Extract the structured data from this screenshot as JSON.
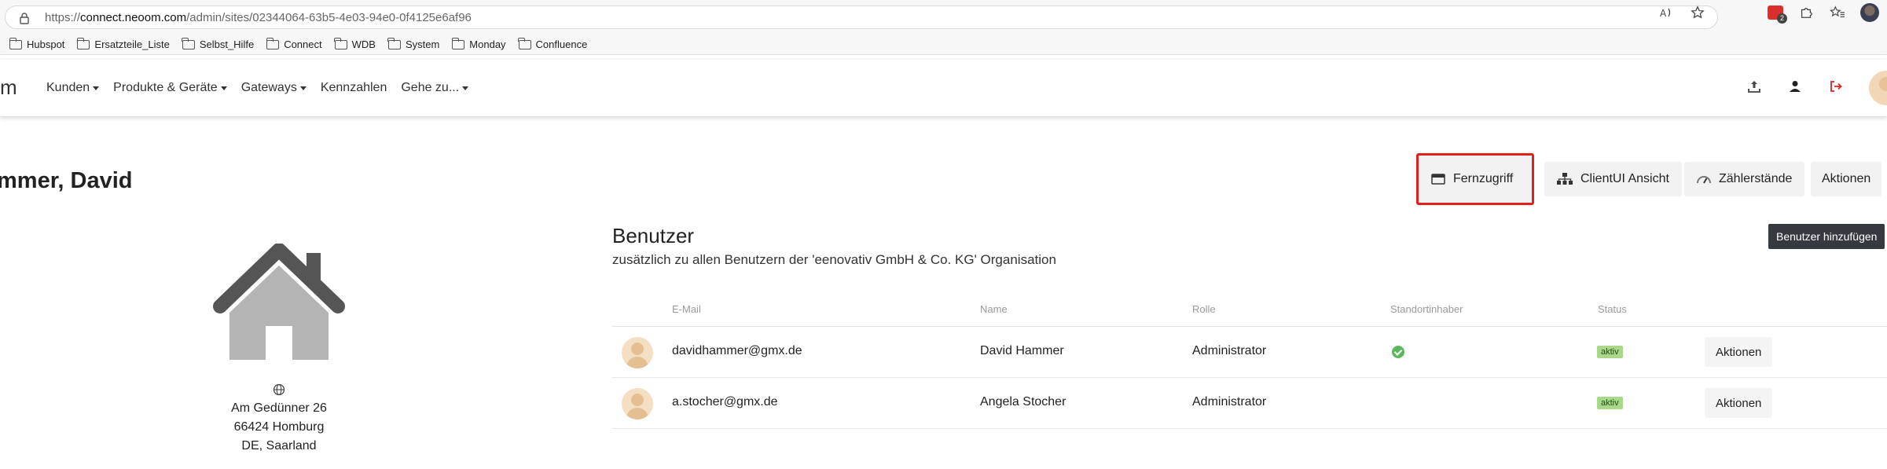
{
  "browser": {
    "url_prefix": "https://",
    "url_domain": "connect.neoom.com",
    "url_path": "/admin/sites/02344064-63b5-4e03-94e0-0f4125e6af96",
    "ext_badge": "2"
  },
  "bookmarks": [
    "Hubspot",
    "Ersatzteile_Liste",
    "Selbst_Hilfe",
    "Connect",
    "WDB",
    "System",
    "Monday",
    "Confluence"
  ],
  "navbar": {
    "logo": "m",
    "items": [
      {
        "label": "Kunden",
        "dropdown": true
      },
      {
        "label": "Produkte & Geräte",
        "dropdown": true
      },
      {
        "label": "Gateways",
        "dropdown": true
      },
      {
        "label": "Kennzahlen",
        "dropdown": false
      },
      {
        "label": "Gehe zu...",
        "dropdown": true
      }
    ]
  },
  "page": {
    "title": "mmer, David",
    "actions": {
      "remote": "Fernzugriff",
      "client_ui": "ClientUI Ansicht",
      "meter": "Zählerstände",
      "actions": "Aktionen"
    }
  },
  "site": {
    "street": "Am Gedünner 26",
    "city": "66424 Homburg",
    "region": "DE, Saarland"
  },
  "users": {
    "title": "Benutzer",
    "subtitle": "zusätzlich zu allen Benutzern der 'eenovativ GmbH & Co. KG' Organisation",
    "add_button": "Benutzer hinzufügen",
    "columns": {
      "email": "E-Mail",
      "name": "Name",
      "role": "Rolle",
      "owner": "Standortinhaber",
      "status": "Status"
    },
    "rows": [
      {
        "email": "davidhammer@gmx.de",
        "name": "David Hammer",
        "role": "Administrator",
        "owner": true,
        "status": "aktiv",
        "action": "Aktionen"
      },
      {
        "email": "a.stocher@gmx.de",
        "name": "Angela Stocher",
        "role": "Administrator",
        "owner": false,
        "status": "aktiv",
        "action": "Aktionen"
      }
    ]
  },
  "colors": {
    "highlight": "#e0201d",
    "status_badge": "#a8d98a",
    "owner_check": "#5cb85c",
    "dark_button": "#343a40"
  }
}
